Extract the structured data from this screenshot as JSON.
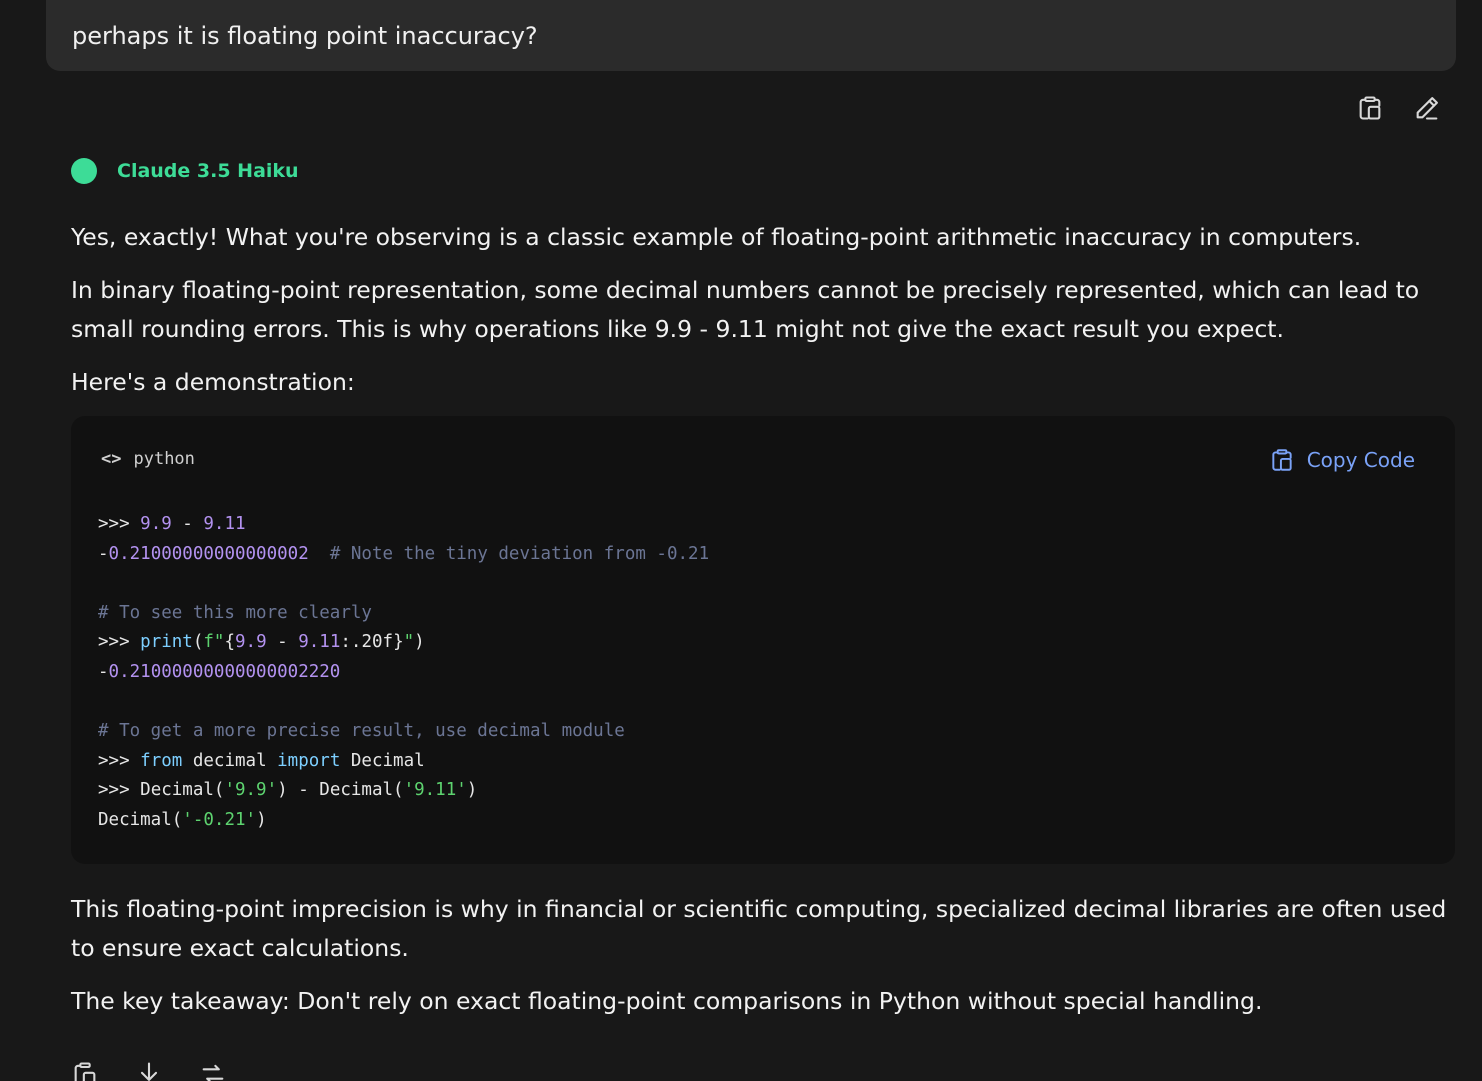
{
  "user_message": {
    "text": "perhaps it is floating point inaccuracy?"
  },
  "message_actions": {
    "copy_icon": "copy-icon",
    "edit_icon": "pencil-icon"
  },
  "assistant": {
    "model_name": "Claude 3.5 Haiku",
    "model_color": "#3ddc97",
    "paragraphs": [
      "Yes, exactly! What you're observing is a classic example of floating-point arithmetic inaccuracy in computers.",
      "In binary floating-point representation, some decimal numbers cannot be precisely represented, which can lead to small rounding errors. This is why operations like 9.9 - 9.11 might not give the exact result you expect.",
      "Here's a demonstration:"
    ],
    "closing_paragraphs": [
      "This floating-point imprecision is why in financial or scientific computing, specialized decimal libraries are often used to ensure exact calculations.",
      "The key takeaway: Don't rely on exact floating-point comparisons in Python without special handling."
    ]
  },
  "code_block": {
    "language": "python",
    "lang_icon": "<>",
    "copy_label": "Copy Code",
    "lines": [
      [
        {
          "t": ">>> ",
          "c": "p"
        },
        {
          "t": "9.9",
          "c": "n"
        },
        {
          "t": " - ",
          "c": "o"
        },
        {
          "t": "9.11",
          "c": "n"
        }
      ],
      [
        {
          "t": "-",
          "c": "o"
        },
        {
          "t": "0.21000000000000002",
          "c": "n"
        },
        {
          "t": "  ",
          "c": "o"
        },
        {
          "t": "# Note the tiny deviation from -0.21",
          "c": "c"
        }
      ],
      [],
      [
        {
          "t": "# To see this more clearly",
          "c": "c"
        }
      ],
      [
        {
          "t": ">>> ",
          "c": "p"
        },
        {
          "t": "print",
          "c": "f"
        },
        {
          "t": "(",
          "c": "o"
        },
        {
          "t": "f\"",
          "c": "s"
        },
        {
          "t": "{",
          "c": "o"
        },
        {
          "t": "9.9",
          "c": "n"
        },
        {
          "t": " - ",
          "c": "o"
        },
        {
          "t": "9.11",
          "c": "n"
        },
        {
          "t": ":.20f}",
          "c": "o"
        },
        {
          "t": "\"",
          "c": "s"
        },
        {
          "t": ")",
          "c": "o"
        }
      ],
      [
        {
          "t": "-",
          "c": "o"
        },
        {
          "t": "0.21000000000000002220",
          "c": "n"
        }
      ],
      [],
      [
        {
          "t": "# To get a more precise result, use decimal module",
          "c": "c"
        }
      ],
      [
        {
          "t": ">>> ",
          "c": "p"
        },
        {
          "t": "from",
          "c": "k"
        },
        {
          "t": " decimal ",
          "c": "o"
        },
        {
          "t": "import",
          "c": "k"
        },
        {
          "t": " Decimal",
          "c": "o"
        }
      ],
      [
        {
          "t": ">>> ",
          "c": "p"
        },
        {
          "t": "Decimal(",
          "c": "o"
        },
        {
          "t": "'9.9'",
          "c": "s"
        },
        {
          "t": ") - Decimal(",
          "c": "o"
        },
        {
          "t": "'9.11'",
          "c": "s"
        },
        {
          "t": ")",
          "c": "o"
        }
      ],
      [
        {
          "t": "Decimal(",
          "c": "o"
        },
        {
          "t": "'-0.21'",
          "c": "s"
        },
        {
          "t": ")",
          "c": "o"
        }
      ]
    ]
  },
  "footer_actions": {
    "icons": [
      "copy-icon",
      "download-icon",
      "retry-icon"
    ]
  }
}
